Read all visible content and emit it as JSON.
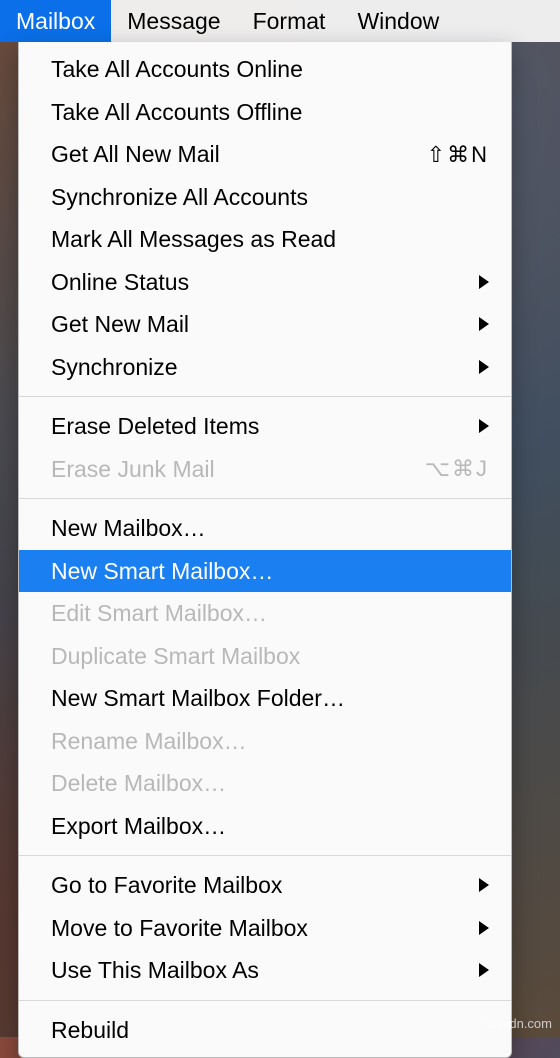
{
  "menubar": {
    "items": [
      {
        "label": "Mailbox",
        "active": true
      },
      {
        "label": "Message",
        "active": false
      },
      {
        "label": "Format",
        "active": false
      },
      {
        "label": "Window",
        "active": false
      }
    ]
  },
  "dropdown": {
    "groups": [
      [
        {
          "label": "Take All Accounts Online",
          "disabled": false,
          "shortcut": "",
          "submenu": false
        },
        {
          "label": "Take All Accounts Offline",
          "disabled": false,
          "shortcut": "",
          "submenu": false
        },
        {
          "label": "Get All New Mail",
          "disabled": false,
          "shortcut": "⇧⌘N",
          "submenu": false
        },
        {
          "label": "Synchronize All Accounts",
          "disabled": false,
          "shortcut": "",
          "submenu": false
        },
        {
          "label": "Mark All Messages as Read",
          "disabled": false,
          "shortcut": "",
          "submenu": false
        },
        {
          "label": "Online Status",
          "disabled": false,
          "shortcut": "",
          "submenu": true
        },
        {
          "label": "Get New Mail",
          "disabled": false,
          "shortcut": "",
          "submenu": true
        },
        {
          "label": "Synchronize",
          "disabled": false,
          "shortcut": "",
          "submenu": true
        }
      ],
      [
        {
          "label": "Erase Deleted Items",
          "disabled": false,
          "shortcut": "",
          "submenu": true
        },
        {
          "label": "Erase Junk Mail",
          "disabled": true,
          "shortcut": "⌥⌘J",
          "submenu": false
        }
      ],
      [
        {
          "label": "New Mailbox…",
          "disabled": false,
          "shortcut": "",
          "submenu": false
        },
        {
          "label": "New Smart Mailbox…",
          "disabled": false,
          "shortcut": "",
          "submenu": false,
          "highlighted": true
        },
        {
          "label": "Edit Smart Mailbox…",
          "disabled": true,
          "shortcut": "",
          "submenu": false
        },
        {
          "label": "Duplicate Smart Mailbox",
          "disabled": true,
          "shortcut": "",
          "submenu": false
        },
        {
          "label": "New Smart Mailbox Folder…",
          "disabled": false,
          "shortcut": "",
          "submenu": false
        },
        {
          "label": "Rename Mailbox…",
          "disabled": true,
          "shortcut": "",
          "submenu": false
        },
        {
          "label": "Delete Mailbox…",
          "disabled": true,
          "shortcut": "",
          "submenu": false
        },
        {
          "label": "Export Mailbox…",
          "disabled": false,
          "shortcut": "",
          "submenu": false
        }
      ],
      [
        {
          "label": "Go to Favorite Mailbox",
          "disabled": false,
          "shortcut": "",
          "submenu": true
        },
        {
          "label": "Move to Favorite Mailbox",
          "disabled": false,
          "shortcut": "",
          "submenu": true
        },
        {
          "label": "Use This Mailbox As",
          "disabled": false,
          "shortcut": "",
          "submenu": true
        }
      ],
      [
        {
          "label": "Rebuild",
          "disabled": false,
          "shortcut": "",
          "submenu": false
        }
      ]
    ]
  },
  "watermark": "wsxdn.com"
}
